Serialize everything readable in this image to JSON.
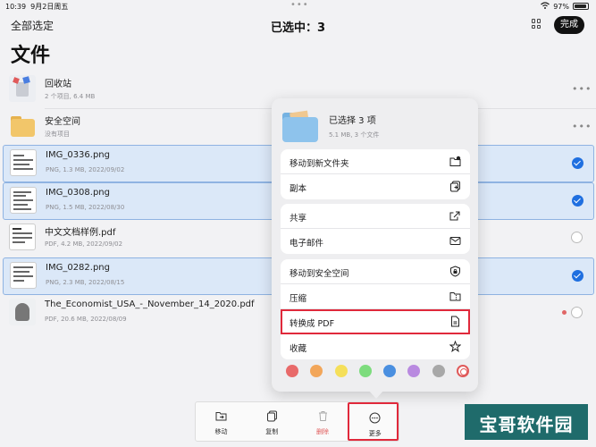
{
  "status": {
    "time": "10:39",
    "date": "9月2日周五",
    "battery": "97%"
  },
  "topbar": {
    "select_all": "全部选定",
    "selected_title": "已选中：3",
    "done": "完成"
  },
  "page_title": "文件",
  "files": [
    {
      "name": "回收站",
      "meta": "2 个项目, 6.4 MB",
      "selected": false
    },
    {
      "name": "安全空间",
      "meta": "没有项目",
      "selected": false
    },
    {
      "name": "IMG_0336.png",
      "meta": "PNG, 1.3 MB, 2022/09/02",
      "selected": true
    },
    {
      "name": "IMG_0308.png",
      "meta": "PNG, 1.5 MB, 2022/08/30",
      "selected": true
    },
    {
      "name": "中文文档样例.pdf",
      "meta": "PDF, 4.2 MB, 2022/09/02",
      "selected": false
    },
    {
      "name": "IMG_0282.png",
      "meta": "PNG, 2.3 MB, 2022/08/15",
      "selected": true
    },
    {
      "name": "The_Economist_USA_-_November_14_2020.pdf",
      "meta": "PDF, 20.6 MB, 2022/08/09",
      "selected": false
    }
  ],
  "popover": {
    "title": "已选择 3 项",
    "subtitle": "5.1 MB, 3 个文件",
    "group1": {
      "move_new_folder": "移动到新文件夹",
      "duplicate": "副本"
    },
    "group2": {
      "share": "共享",
      "email": "电子邮件"
    },
    "group3": {
      "move_secure": "移动到安全空间",
      "compress": "压缩",
      "convert_pdf": "转换成 PDF",
      "favorite": "收藏"
    },
    "tag_colors": [
      "#e86a6a",
      "#f2a65a",
      "#f5df5a",
      "#7ddc7d",
      "#4a8fe0",
      "#b98ae0",
      "#a8a8a8"
    ]
  },
  "toolbar": {
    "move": "移动",
    "copy": "复制",
    "delete": "删除",
    "more": "更多"
  },
  "watermark": "宝哥软件园"
}
